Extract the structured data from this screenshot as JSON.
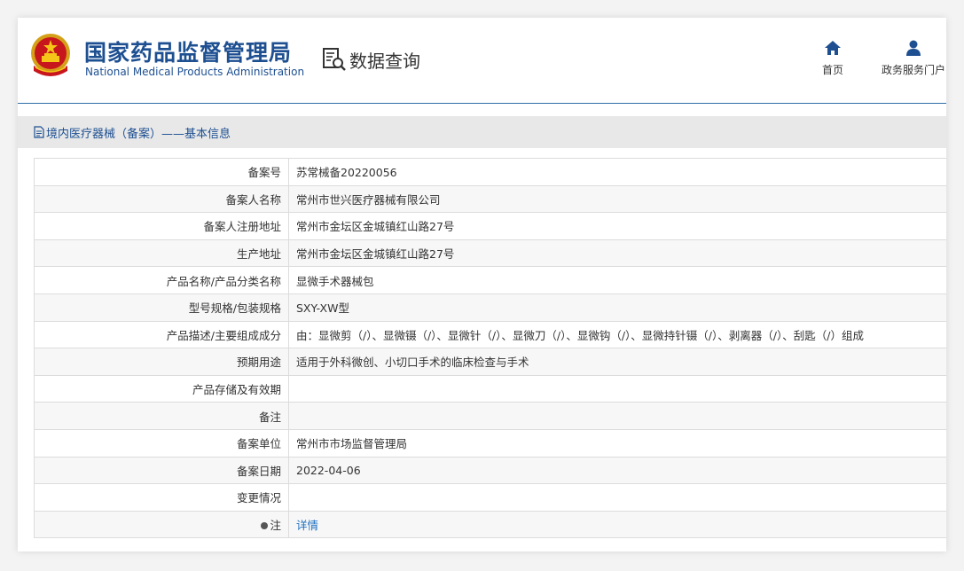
{
  "header": {
    "logo_cn": "国家药品监督管理局",
    "logo_en": "National Medical Products Administration",
    "query_title": "数据查询",
    "nav": [
      {
        "label": "首页",
        "icon": "home-icon"
      },
      {
        "label": "政务服务门户",
        "icon": "user-icon"
      }
    ]
  },
  "section": {
    "title": "境内医疗器械（备案）——基本信息"
  },
  "rows": [
    {
      "label": "备案号",
      "value": "苏常械备20220056"
    },
    {
      "label": "备案人名称",
      "value": "常州市世兴医疗器械有限公司"
    },
    {
      "label": "备案人注册地址",
      "value": "常州市金坛区金城镇红山路27号"
    },
    {
      "label": "生产地址",
      "value": "常州市金坛区金城镇红山路27号"
    },
    {
      "label": "产品名称/产品分类名称",
      "value": "显微手术器械包"
    },
    {
      "label": "型号规格/包装规格",
      "value": "SXY-XW型"
    },
    {
      "label": "产品描述/主要组成成分",
      "value": "由：显微剪（/）、显微镊（/）、显微针（/）、显微刀（/）、显微钩（/）、显微持针镊（/）、剥离器（/）、刮匙（/）组成"
    },
    {
      "label": "预期用途",
      "value": "适用于外科微创、小切口手术的临床检查与手术"
    },
    {
      "label": "产品存储及有效期",
      "value": ""
    },
    {
      "label": "备注",
      "value": ""
    },
    {
      "label": "备案单位",
      "value": "常州市市场监督管理局"
    },
    {
      "label": "备案日期",
      "value": "2022-04-06"
    },
    {
      "label": "变更情况",
      "value": ""
    }
  ],
  "note_row": {
    "label": "注",
    "link": "详情"
  },
  "colors": {
    "brand_blue": "#1d4f91",
    "link_blue": "#1e6fbf",
    "section_bg": "#e8e8e8"
  }
}
